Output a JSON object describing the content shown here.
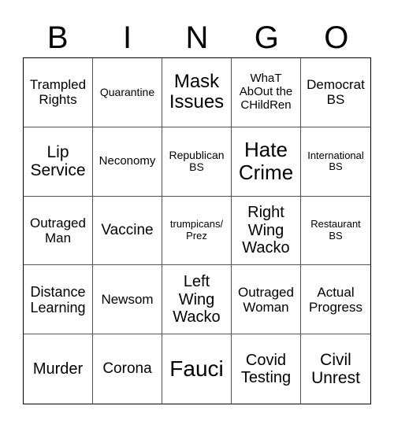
{
  "header": {
    "letters": [
      "B",
      "I",
      "N",
      "G",
      "O"
    ]
  },
  "board": {
    "rows": [
      [
        "Trampled Rights",
        "Quarantine",
        "Mask Issues",
        "WhaT AbOut the CHildRen",
        "Democrat BS"
      ],
      [
        "Lip Service",
        "Neconomy",
        "Republican BS",
        "Hate Crime",
        "International BS"
      ],
      [
        "Outraged Man",
        "Vaccine",
        "trumpicans/ Prez",
        "Right Wing Wacko",
        "Restaurant BS"
      ],
      [
        "Distance Learning",
        "Newsom",
        "Left Wing Wacko",
        "Outraged Woman",
        "Actual Progress"
      ],
      [
        "Murder",
        "Corona",
        "Fauci",
        "Covid Testing",
        "Civil Unrest"
      ]
    ]
  }
}
